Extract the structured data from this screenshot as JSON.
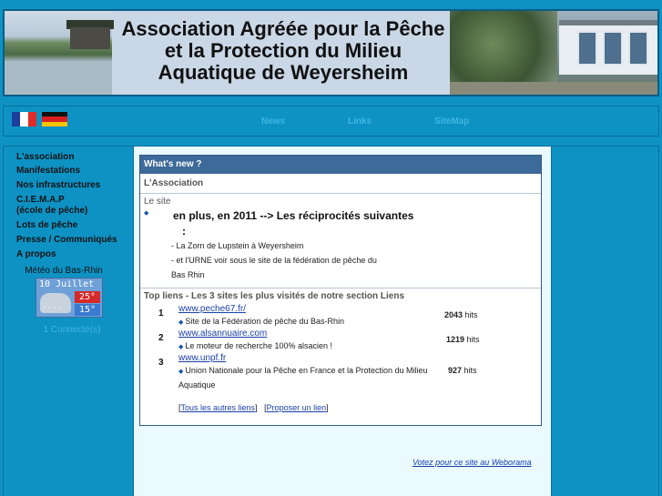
{
  "header": {
    "title": "Association Agréée pour la Pêche et la Protection du Milieu Aquatique de Weyersheim"
  },
  "nav": {
    "flags": [
      "flag-fr-icon",
      "flag-de-icon"
    ],
    "items": [
      "News",
      "Links",
      "SiteMap"
    ]
  },
  "sidebar": {
    "items": [
      "L'association",
      "Manifestations",
      "Nos infrastructures",
      "C.I.E.M.A.P (école de pêche)",
      "Lots de pêche",
      "Presse / Communiqués",
      "A propos"
    ],
    "item_lines": [
      [
        "L'association"
      ],
      [
        "Manifestations"
      ],
      [
        "Nos infrastructures"
      ],
      [
        "C.I.E.M.A.P",
        "(école de pêche)"
      ],
      [
        "Lots de pêche"
      ],
      [
        "Presse / Communiqués"
      ],
      [
        "A propos"
      ]
    ],
    "meteo": {
      "label": "Météo du Bas-Rhin",
      "date": "10 Juillet",
      "max": "25°",
      "min": "15°"
    },
    "connected": "1 Connecté(s)"
  },
  "news": {
    "heading": "What's new ?",
    "section": "L'Association",
    "site": {
      "title": "Le site",
      "headline": "en plus, en 2011 --> Les réciprocités suivantes",
      "colon": ":",
      "line1": "- La Zorn de Lupstein à Weyersheim",
      "line2": "- et l'URNE voir sous le site de la fédération de pêche du",
      "line3": "Bas Rhin"
    },
    "top_links": {
      "title": "Top liens - Les 3 sites les plus visités de notre section Liens",
      "items": [
        {
          "num": "1",
          "url": "www.peche67.fr/",
          "desc": "Site de la Fédération de pêche du Bas-Rhin",
          "hits": "2043",
          "hits_label": "hits"
        },
        {
          "num": "2",
          "url": "www.alsannuaire.com",
          "desc": "Le moteur de recherche 100% alsacien !",
          "hits": "1219",
          "hits_label": "hits"
        },
        {
          "num": "3",
          "url": "www.unpf.fr",
          "desc": "Union Nationale pour la Pêche en France et la Protection du Milieu Aquatique",
          "hits": "927",
          "hits_label": "hits"
        }
      ],
      "all_links": "Tous les autres liens",
      "propose": "Proposer un lien"
    }
  },
  "footer": {
    "weborama": "Votez pour ce site au Weborama"
  }
}
